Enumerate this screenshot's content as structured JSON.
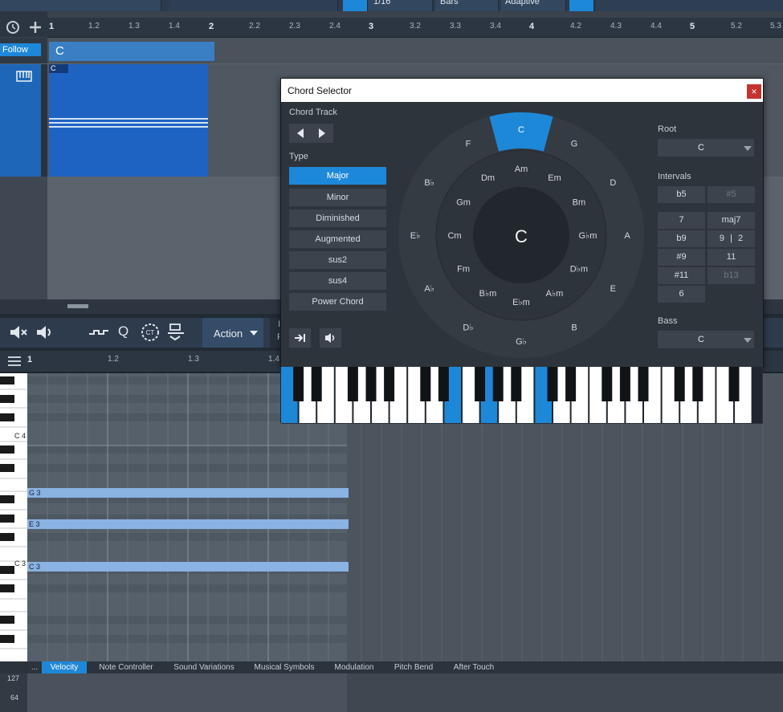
{
  "toolbar": {
    "quantize": "1/16",
    "timebase": "Bars",
    "snap": "Adaptive"
  },
  "upper_ruler": {
    "ticks": [
      "1",
      "1.2",
      "1.3",
      "1.4",
      "2",
      "2.2",
      "2.3",
      "2.4",
      "3",
      "3.2",
      "3.3",
      "3.4",
      "4",
      "4.2",
      "4.3",
      "4.4",
      "5",
      "5.2",
      "5.3"
    ]
  },
  "chord_track": {
    "follow_label": "Follow",
    "chord_name": "C",
    "event_label": "C"
  },
  "chord_selector": {
    "title": "Chord Selector",
    "close_glyph": "×",
    "chord_track_label": "Chord Track",
    "type_label": "Type",
    "types": [
      {
        "label": "Major",
        "selected": true
      },
      {
        "label": "Minor",
        "selected": false
      },
      {
        "label": "Diminished",
        "selected": false
      },
      {
        "label": "Augmented",
        "selected": false
      },
      {
        "label": "sus2",
        "selected": false
      },
      {
        "label": "sus4",
        "selected": false
      },
      {
        "label": "Power Chord",
        "selected": false
      }
    ],
    "circle": {
      "center": "C",
      "outer": [
        "C",
        "G",
        "D",
        "A",
        "E",
        "B",
        "G♭",
        "D♭",
        "A♭",
        "E♭",
        "B♭",
        "F"
      ],
      "middle": [
        "Am",
        "Em",
        "Bm",
        "G♭m",
        "D♭m",
        "A♭m",
        "E♭m",
        "B♭m",
        "Fm",
        "Cm",
        "Gm",
        "Dm"
      ],
      "selected_index": 0
    },
    "root_label": "Root",
    "root_value": "C",
    "intervals_label": "Intervals",
    "intervals": {
      "b5": "b5",
      "s5": "#5",
      "i7": "7",
      "maj7": "maj7",
      "b9": "b9",
      "n9": "9",
      "n2": "2",
      "sep": "|",
      "s9": "#9",
      "i11": "11",
      "s11": "#11",
      "b13": "b13",
      "i6": "6"
    },
    "bass_label": "Bass",
    "bass_value": "C",
    "accent_color": "#1e88d8"
  },
  "piano_roll": {
    "action_label": "Action",
    "partial_labels": [
      "I",
      "F"
    ],
    "ruler_ticks": [
      "1",
      "1.2",
      "1.3",
      "1.4"
    ],
    "key_labels": {
      "c4": "C 4",
      "c3": "C 3"
    },
    "notes": [
      {
        "label": "G 3"
      },
      {
        "label": "E 3"
      },
      {
        "label": "C 3"
      }
    ],
    "more_glyph": "...",
    "tabs": [
      "Velocity",
      "Note Controller",
      "Sound Variations",
      "Musical Symbols",
      "Modulation",
      "Pitch Bend",
      "After Touch"
    ],
    "velocity_max": "127",
    "velocity_mid": "64"
  }
}
